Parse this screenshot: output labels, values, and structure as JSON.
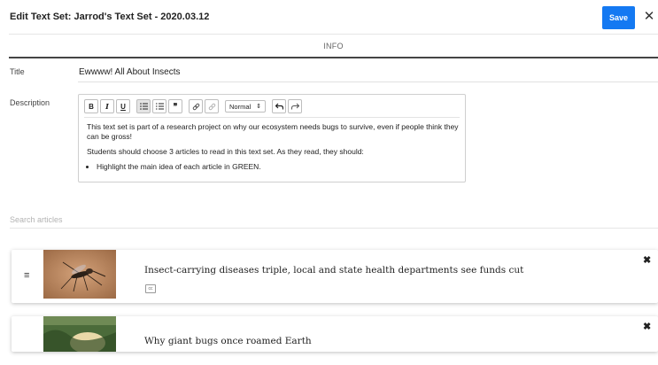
{
  "header": {
    "title": "Edit Text Set: Jarrod's Text Set - 2020.03.12",
    "save_label": "Save",
    "close_glyph": "✕",
    "accent_color": "#1479f2"
  },
  "tabs": [
    {
      "label": "INFO",
      "active": true
    }
  ],
  "form": {
    "title_label": "Title",
    "title_value": "Ewwww! All About Insects",
    "description_label": "Description"
  },
  "editor": {
    "toolbar": {
      "bold": "B",
      "italic": "I",
      "underline": "U",
      "format_select": "Normal",
      "icons": [
        "bold-icon",
        "italic-icon",
        "underline-icon",
        "bullet-list-icon",
        "numbered-list-icon",
        "quote-icon",
        "link-icon",
        "unlink-icon",
        "undo-icon",
        "redo-icon"
      ]
    },
    "paragraphs": [
      "This text set is part of a research project on why our ecosystem needs bugs to survive, even if people think they can be gross!",
      "Students should choose 3 articles to read in this text set. As they read, they should:"
    ],
    "bullets": [
      "Highlight the main idea of each article in GREEN."
    ]
  },
  "search": {
    "placeholder": "Search articles",
    "value": ""
  },
  "articles": [
    {
      "title": "Insect-carrying diseases triple, local and state health departments see funds cut"
    },
    {
      "title": "Why giant bugs once roamed Earth"
    }
  ]
}
